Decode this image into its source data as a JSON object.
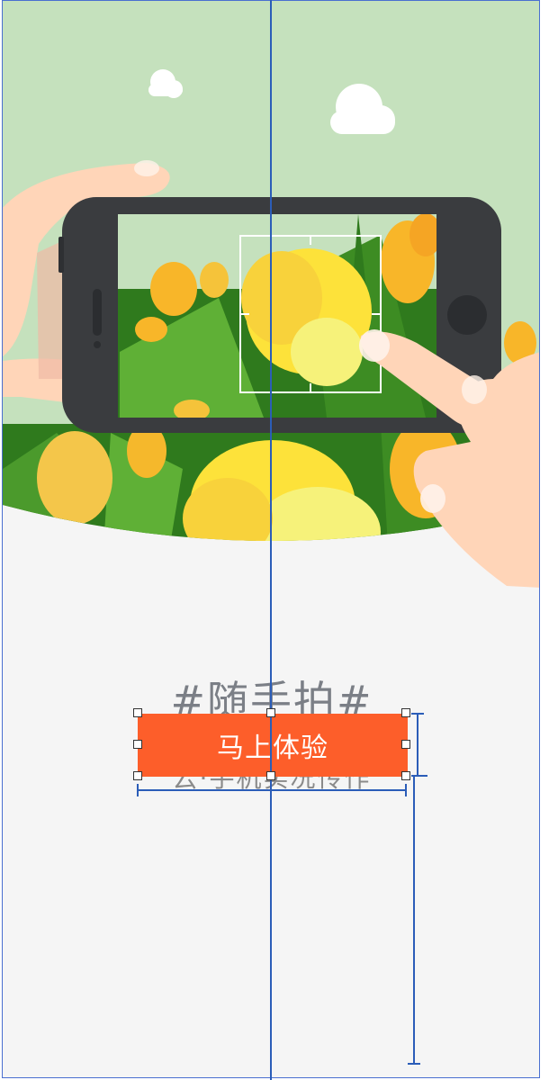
{
  "banner": {
    "slogan": "#随手拍#",
    "subtitle": "云·手机实况传作",
    "cta_label": "马上体验"
  },
  "colors": {
    "sky": "#c5e1bd",
    "background": "#f5f5f5",
    "button": "#fd5e2a",
    "phone_body": "#3a3c3f",
    "skin": "#ffd5b8",
    "tulip_yellow": "#fde23a",
    "tulip_orange": "#f8b629",
    "leaf_green": "#3d8c23",
    "guide_blue": "#2b5db8"
  },
  "icons": [
    "cloud-icon",
    "tulip-illustration",
    "phone-illustration",
    "hand-illustration",
    "focus-frame-icon"
  ]
}
